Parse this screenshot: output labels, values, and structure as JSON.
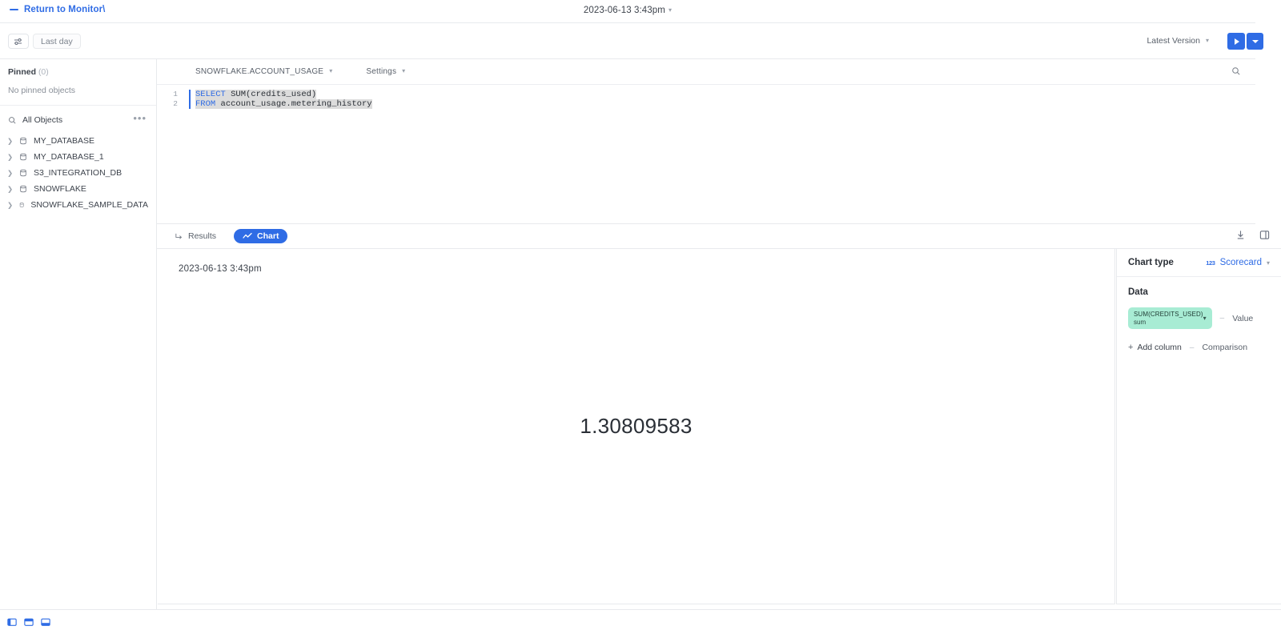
{
  "topbar": {
    "return_label": "Return to Monitor\\",
    "title": "2023-06-13 3:43pm",
    "title_caret": "▾"
  },
  "toolbar": {
    "filter_icon": "sliders-icon",
    "time_range_chip": "Last day",
    "version_label": "Latest Version",
    "version_caret": "▾",
    "run_button": "run-icon",
    "run_menu": "chevron-down-icon"
  },
  "sidebar": {
    "pinned_label": "Pinned",
    "pinned_count": "(0)",
    "pinned_empty": "No pinned objects",
    "all_objects_label": "All Objects",
    "more_label": "•••",
    "objects": [
      {
        "label": "MY_DATABASE"
      },
      {
        "label": "MY_DATABASE_1"
      },
      {
        "label": "S3_INTEGRATION_DB"
      },
      {
        "label": "SNOWFLAKE"
      },
      {
        "label": "SNOWFLAKE_SAMPLE_DATA"
      }
    ]
  },
  "editor": {
    "schema_select": "SNOWFLAKE.ACCOUNT_USAGE",
    "schema_caret": "▾",
    "settings_select": "Settings",
    "settings_caret": "▾",
    "search_icon": "search-icon",
    "lines": [
      {
        "number": "1",
        "keyword": "SELECT",
        "rest": " SUM(credits_used)"
      },
      {
        "number": "2",
        "keyword": "FROM",
        "rest": " account_usage.metering_history"
      }
    ]
  },
  "results": {
    "tabs": [
      {
        "label": "Results",
        "icon": "arrow-return-icon",
        "active": false
      },
      {
        "label": "Chart",
        "icon": "line-chart-icon",
        "active": true
      }
    ],
    "download_icon": "download-icon",
    "layout_icon": "split-panel-icon"
  },
  "chart_data": {
    "type": "scorecard",
    "title": "2023-06-13 3:43pm",
    "value": "1.30809583",
    "series": [
      {
        "name": "SUM(CREDITS_USED)",
        "aggregate": "sum",
        "role": "Value",
        "value": 1.30809583
      }
    ],
    "xlabel": "",
    "ylabel": "",
    "legend": false,
    "grid": false
  },
  "config": {
    "chart_type_label": "Chart type",
    "chart_type_value": "Scorecard",
    "chart_type_badge": "123",
    "chart_type_caret": "▾",
    "data_label": "Data",
    "column_pill": {
      "name": "SUM(CREDITS_USED)",
      "aggregate": "sum",
      "caret": "▾"
    },
    "value_role": "Value",
    "comparison_role": "Comparison",
    "add_column": "Add column",
    "add_icon": "+",
    "dash": "–"
  },
  "statusbar": {
    "panels": [
      {
        "name": "left-panel-toggle"
      },
      {
        "name": "top-panel-toggle"
      },
      {
        "name": "bottom-panel-toggle"
      }
    ]
  },
  "colors": {
    "accent": "#2f6ce5",
    "pill": "#a8ecd4",
    "border": "#e8eaed"
  }
}
